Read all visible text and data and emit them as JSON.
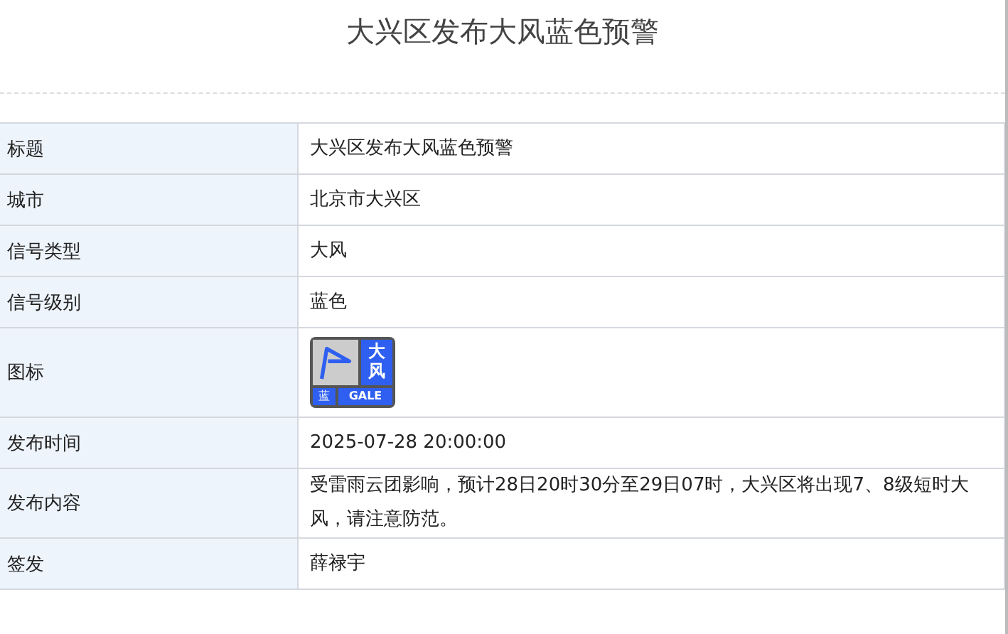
{
  "title": "大兴区发布大风蓝色预警",
  "rows": [
    {
      "label": "标题",
      "kind": "text",
      "value": "大兴区发布大风蓝色预警"
    },
    {
      "label": "城市",
      "kind": "text",
      "value": "北京市大兴区"
    },
    {
      "label": "信号类型",
      "kind": "text",
      "value": "大风"
    },
    {
      "label": "信号级别",
      "kind": "text",
      "value": "蓝色"
    },
    {
      "label": "图标",
      "kind": "icon",
      "icon": {
        "name": "大风",
        "level": "蓝",
        "code": "GALE",
        "color": "#2f5ff0"
      }
    },
    {
      "label": "发布时间",
      "kind": "text",
      "value": "2025-07-28 20:00:00"
    },
    {
      "label": "发布内容",
      "kind": "text",
      "value": "受雷雨云团影响，预计28日20时30分至29日07时，大兴区将出现7、8级短时大风，请注意防范。"
    },
    {
      "label": "签发",
      "kind": "text",
      "value": "薛禄宇"
    }
  ]
}
